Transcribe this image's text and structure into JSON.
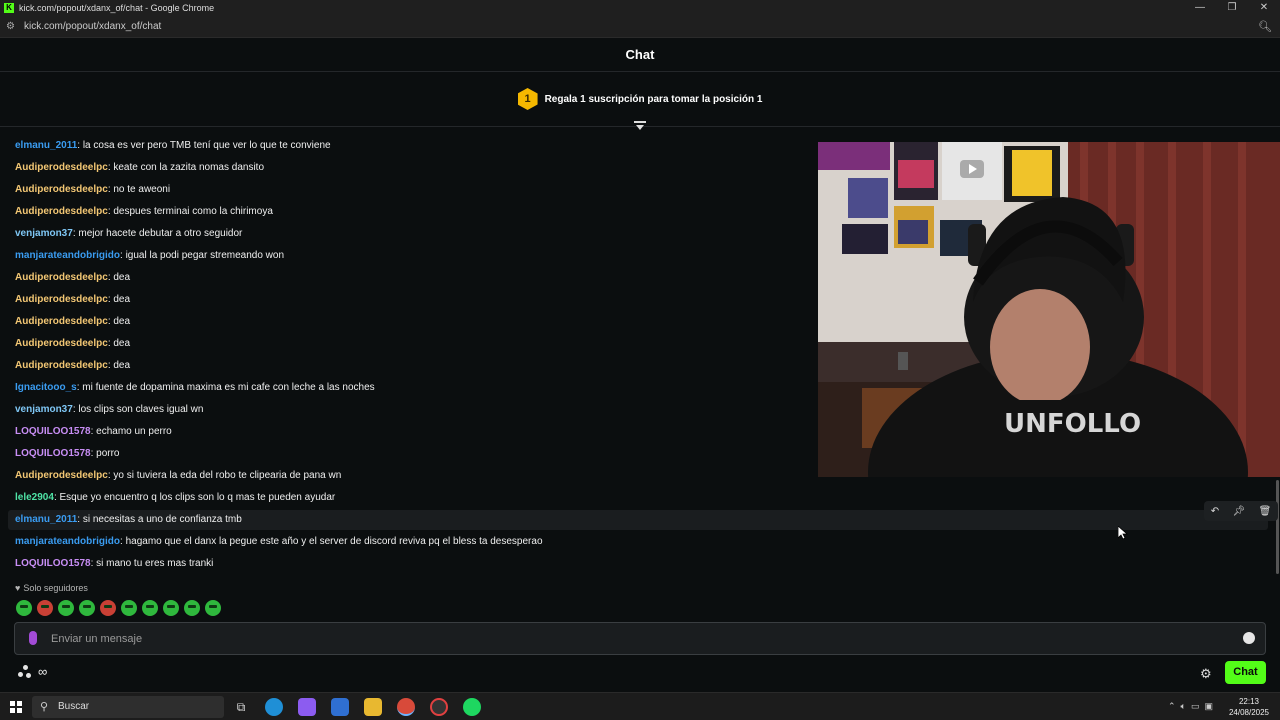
{
  "window": {
    "title": "kick.com/popout/xdanx_of/chat - Google Chrome",
    "url": "kick.com/popout/xdanx_of/chat",
    "controls": [
      "—",
      "❐",
      "✕"
    ]
  },
  "chat": {
    "header": "Chat",
    "pinned_message": "Regala 1 suscripción para tomar la posición 1",
    "pinned_badge": "1",
    "messages": [
      {
        "user": "elmanu_2011",
        "text": "la cosa es ver pero TMB tení que ver lo que te conviene",
        "color": "#3a9cf1"
      },
      {
        "user": "Audiperodesdeelpc",
        "text": "keate con la zazita nomas dansito",
        "color": "#f3c774"
      },
      {
        "user": "Audiperodesdeelpc",
        "text": "no te aweoni",
        "color": "#f3c774"
      },
      {
        "user": "Audiperodesdeelpc",
        "text": "despues terminai como la chirimoya",
        "color": "#f3c774"
      },
      {
        "user": "venjamon37",
        "text": "mejor hacete debutar a otro seguidor",
        "color": "#7fc7f5"
      },
      {
        "user": "manjarateandobrigido",
        "text": "igual la podi pegar stremeando won",
        "color": "#3a9cf1"
      },
      {
        "user": "Audiperodesdeelpc",
        "text": "dea",
        "color": "#f3c774"
      },
      {
        "user": "Audiperodesdeelpc",
        "text": "dea",
        "color": "#f3c774"
      },
      {
        "user": "Audiperodesdeelpc",
        "text": "dea",
        "color": "#f3c774"
      },
      {
        "user": "Audiperodesdeelpc",
        "text": "dea",
        "color": "#f3c774"
      },
      {
        "user": "Audiperodesdeelpc",
        "text": "dea",
        "color": "#f3c774"
      },
      {
        "user": "Ignacitooo_s",
        "text": "mi fuente de dopamina maxima es mi cafe con leche a las noches",
        "color": "#3a9cf1"
      },
      {
        "user": "venjamon37",
        "text": "los clips son claves igual wn",
        "color": "#7fc7f5"
      },
      {
        "user": "LOQUILOO1578",
        "text": "echamo un perro",
        "color": "#c88ef5"
      },
      {
        "user": "LOQUILOO1578",
        "text": "porro",
        "color": "#c88ef5"
      },
      {
        "user": "Audiperodesdeelpc",
        "text": "yo si tuviera la eda del robo te clipearia de pana wn",
        "color": "#f3c774"
      },
      {
        "user": "lele2904",
        "text": "Esque yo encuentro q los clips son lo q mas te pueden ayudar",
        "color": "#4fe3a6"
      },
      {
        "user": "elmanu_2011",
        "text": "si necesitas a uno de confianza tmb",
        "color": "#3a9cf1"
      },
      {
        "user": "manjarateandobrigido",
        "text": "hagamo que el danx la pegue este año y el server de discord reviva pq el bless ta desesperao",
        "color": "#3a9cf1"
      },
      {
        "user": "LOQUILOO1578",
        "text": "si mano tu eres mas tranki",
        "color": "#c88ef5"
      }
    ],
    "followers_only": "Solo seguidores",
    "input_placeholder": "Enviar un mensaje",
    "chat_button": "Chat",
    "infinity": "∞"
  },
  "taskbar": {
    "search_placeholder": "Buscar",
    "time": "22:13",
    "date": "24/08/2025"
  },
  "colors": {
    "accent": "#53fc18",
    "background": "#0b0e0f"
  }
}
